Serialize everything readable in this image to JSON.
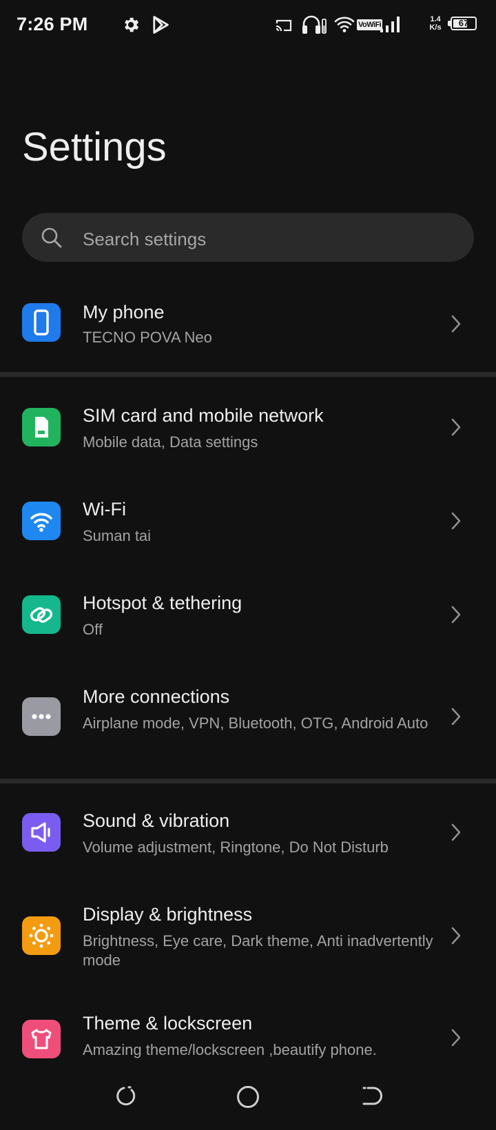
{
  "status_bar": {
    "time": "7:26 PM",
    "icons": [
      "gear-icon",
      "play-store-icon",
      "cast-icon",
      "headset-icon",
      "wifi-icon",
      "vowifi-icon",
      "signal-icon"
    ],
    "vowifi_label": "VoWiFi",
    "speed_value": "1.4",
    "speed_unit": "K/s",
    "battery_percent": "67",
    "battery_level": 0.67
  },
  "page": {
    "title": "Settings"
  },
  "search": {
    "placeholder": "Search settings"
  },
  "sections": [
    {
      "items": [
        {
          "icon": "phone-icon",
          "color": "#1f7aeb",
          "title": "My phone",
          "subtitle": "TECNO POVA Neo"
        }
      ]
    },
    {
      "items": [
        {
          "icon": "sim-card-icon",
          "color": "#22b35e",
          "title": "SIM card and mobile network",
          "subtitle": "Mobile data, Data settings"
        },
        {
          "icon": "wifi-icon",
          "color": "#1e88f0",
          "title": "Wi-Fi",
          "subtitle": "Suman tai"
        },
        {
          "icon": "hotspot-icon",
          "color": "#14b88c",
          "title": "Hotspot & tethering",
          "subtitle": "Off"
        },
        {
          "icon": "more-dots-icon",
          "color": "#9a9aa3",
          "title": "More connections",
          "subtitle": "Airplane mode, VPN, Bluetooth, OTG, Android Auto"
        }
      ]
    },
    {
      "items": [
        {
          "icon": "speaker-icon",
          "color": "#7b5cf0",
          "title": "Sound & vibration",
          "subtitle": "Volume adjustment, Ringtone, Do Not Disturb"
        },
        {
          "icon": "sun-icon",
          "color": "#f39c12",
          "title": "Display & brightness",
          "subtitle": "Brightness, Eye care, Dark theme, Anti inadvertently mode"
        },
        {
          "icon": "tshirt-icon",
          "color": "#ef4e7b",
          "title": "Theme & lockscreen",
          "subtitle": "Amazing theme/lockscreen ,beautify phone."
        }
      ]
    }
  ],
  "nav_bar": {
    "buttons": [
      "recents-icon",
      "home-icon",
      "back-icon"
    ]
  }
}
